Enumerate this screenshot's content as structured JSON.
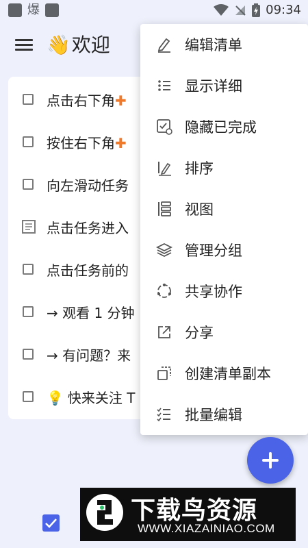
{
  "status_bar": {
    "left_char": "爆",
    "time": "09:34"
  },
  "app": {
    "title": "欢迎",
    "title_emoji": "👋"
  },
  "tasks": [
    {
      "text": "点击右下角",
      "plus": "✚",
      "type": "checkbox"
    },
    {
      "text": "按住右下角",
      "plus": "✚",
      "type": "checkbox"
    },
    {
      "text": "向左滑动任务",
      "type": "checkbox"
    },
    {
      "text": "点击任务进入",
      "type": "note"
    },
    {
      "text": "点击任务前的",
      "type": "checkbox"
    },
    {
      "text": "→ 观看 1 分钟",
      "type": "checkbox"
    },
    {
      "text": "→ 有问题？来",
      "type": "checkbox"
    },
    {
      "text": "快来关注 T",
      "emoji": "💡",
      "type": "checkbox"
    }
  ],
  "menu": {
    "items": [
      {
        "label": "编辑清单",
        "icon": "pencil-icon"
      },
      {
        "label": "显示详细",
        "icon": "list-details-icon"
      },
      {
        "label": "隐藏已完成",
        "icon": "hide-completed-icon"
      },
      {
        "label": "排序",
        "icon": "sort-icon"
      },
      {
        "label": "视图",
        "icon": "view-icon"
      },
      {
        "label": "管理分组",
        "icon": "layers-icon"
      },
      {
        "label": "共享协作",
        "icon": "share-collab-icon"
      },
      {
        "label": "分享",
        "icon": "external-share-icon"
      },
      {
        "label": "创建清单副本",
        "icon": "duplicate-icon"
      },
      {
        "label": "批量编辑",
        "icon": "batch-edit-icon"
      }
    ]
  },
  "watermark": {
    "brand": "下载鸟资源",
    "url": "WWW.XIAZAINIAO.COM"
  },
  "colors": {
    "accent": "#4a63e7",
    "background": "#eef0fb",
    "plus_orange": "#f07a2a"
  }
}
